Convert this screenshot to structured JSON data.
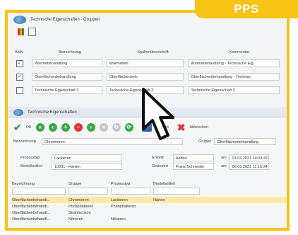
{
  "badge": "PPS",
  "w1": {
    "title": "Technische Eigenschaften - Gruppen",
    "headers": [
      "Aktiv",
      "Bezeichnung",
      "Spaltenüberschrift",
      "Kommentar"
    ],
    "rows": [
      {
        "checked": true,
        "name": "Wärmebehandlung",
        "col": "Wärmebeh.",
        "comment": "Wärmebehandlung - Technische Eig"
      },
      {
        "checked": true,
        "name": "Oberflächenbehandlung",
        "col": "Oberflächenbeh.",
        "comment": "Oberflächenbehandlung - Technisc"
      },
      {
        "checked": false,
        "name": "Technische Eigenschaft 3",
        "col": "Technische Eigenschaft 3",
        "comment": "Technische Eigenschaft 3"
      }
    ]
  },
  "w2": {
    "title": "Technische Eigenschaften",
    "ok": "OK",
    "ansicht": "Ansicht",
    "abbrechen": "Abbrechen",
    "bez_label": "Bezeichnung",
    "bez_value": "Chromieren",
    "gruppe_label": "Gruppe",
    "gruppe_value": "Oberflächenbehandlung",
    "prozess_label": "Prozesstyp",
    "prozess_value": "Lackieren",
    "best_label": "Bestellartikel",
    "best_value": "10031 - Härten",
    "erstellt_label": "Erstellt",
    "erstellt_value": "Admin",
    "erstellt_am": "am",
    "erstellt_date": "01.03.2021 14:03:47",
    "geaendert_label": "Geändert",
    "geaendert_value": "Franz Schneider",
    "geaendert_am": "am",
    "geaendert_date": "09.03.2021 11:15:24",
    "cols": [
      "Bezeichnung",
      "Gruppe",
      "Prozesstyp",
      "Bestellartikel"
    ],
    "rows": [
      [
        "Oberflächenbehandl...",
        "Chromieren",
        "Lackieren",
        "Härten"
      ],
      [
        "Oberflächenbehandl...",
        "Phosphatieren",
        "Phosphatieren",
        ""
      ],
      [
        "Oberflächenbehandl...",
        "Strahlschicht",
        "",
        ""
      ],
      [
        "Oberflächenbehandl...",
        "Nitrieren",
        "Nitrieren",
        ""
      ]
    ]
  },
  "colors": {
    "accent": "#f7c416",
    "selection": "#fde9a6"
  }
}
